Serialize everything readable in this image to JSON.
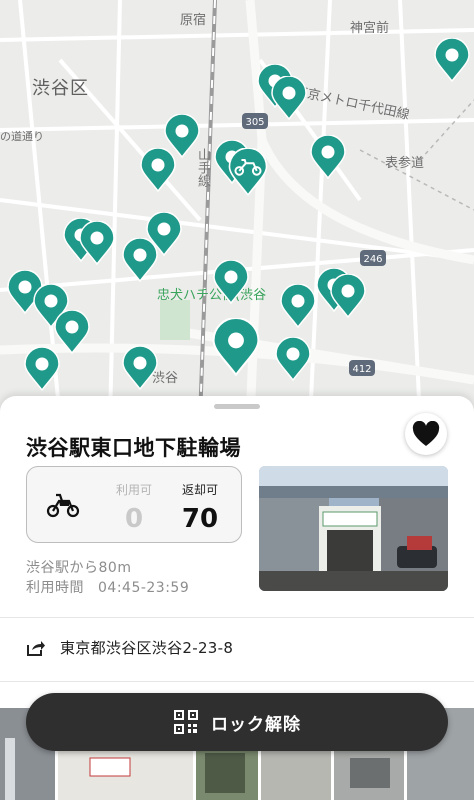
{
  "map": {
    "labels": {
      "ward": "渋谷区",
      "harajuku": "原宿",
      "jingumae": "神宮前",
      "metro_line": "東京メトロ千代田線",
      "omotesando": "表参道",
      "yamanote": "山手線",
      "hachiko": "忠犬ハチ公像(渋谷",
      "shibuya": "渋谷",
      "route_305": "305",
      "route_246": "246",
      "route_412": "412",
      "side_road": "の道通り"
    },
    "pin_color": "#1f9a8a",
    "selected_pin_icon": "bike-icon"
  },
  "station": {
    "name": "渋谷駅東口地下駐輪場",
    "available_label": "利用可",
    "available_count": "0",
    "return_label": "返却可",
    "return_count": "70",
    "distance": "渋谷駅から80m",
    "hours_label": "利用時間",
    "hours_value": "04:45-23:59",
    "address": "東京都渋谷区渋谷2-23-8"
  },
  "actions": {
    "unlock_label": "ロック解除"
  },
  "colors": {
    "accent": "#1f9a8a",
    "button": "#2f2f2f"
  }
}
